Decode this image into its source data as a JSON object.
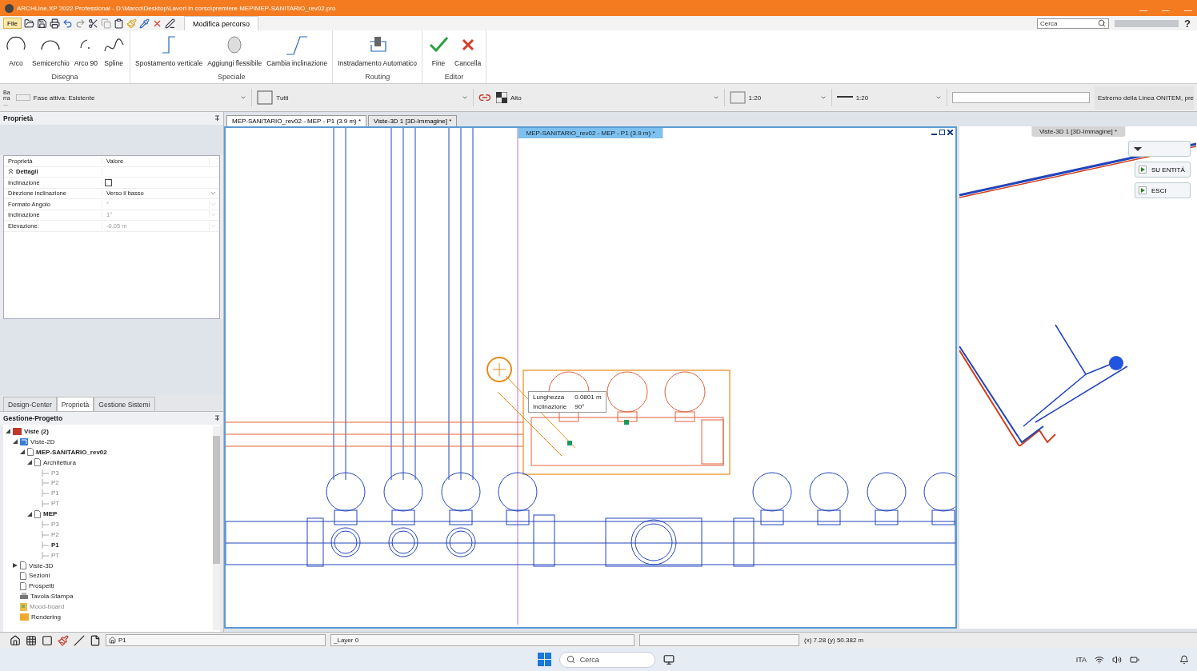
{
  "title_bar": {
    "title": "ARCHLine.XP 2022 Professional - D:\\Marco\\Desktop\\Lavori in corso\\premiere MEP\\MEP-SANITARIO_rev02.pro"
  },
  "quick_access": {
    "file_label": "File",
    "search": {
      "placeholder": "Cerca"
    },
    "help": "?"
  },
  "ribbon": {
    "tabs": [
      {
        "label": "Modifica percorso",
        "selected": true
      }
    ],
    "groups": [
      {
        "label": "Disegna",
        "tools": [
          {
            "label": "Arco",
            "kind": "arc"
          },
          {
            "label": "Semicerchio",
            "kind": "semicircle"
          },
          {
            "label": "Arco 90",
            "kind": "arc90"
          },
          {
            "label": "Spline",
            "kind": "spline"
          }
        ]
      },
      {
        "label": "Speciale",
        "tools": [
          {
            "label": "Spostamento verticale",
            "kind": "vertical"
          },
          {
            "label": "Aggiungi flessibile",
            "kind": "flex"
          },
          {
            "label": "Cambia inclinazione",
            "kind": "slope"
          }
        ]
      },
      {
        "label": "Routing",
        "tools": [
          {
            "label": "Instradamento Automatico",
            "kind": "routing"
          }
        ]
      },
      {
        "label": "Editor",
        "tools": [
          {
            "label": "Fine",
            "kind": "ok"
          },
          {
            "label": "Cancella",
            "kind": "cancel"
          }
        ]
      }
    ]
  },
  "toolbar": {
    "bar_label": "Barra ...",
    "phase": "Fase attiva: Esistente",
    "filter": "Tutti",
    "view_mode": "Alto",
    "scale_1": "1:20",
    "scale_2": "1:20",
    "hint": "Estremo della Linea ONITEM, pre"
  },
  "properties_panel": {
    "title": "Proprietà",
    "columns": [
      "Proprietà",
      "Valore"
    ],
    "section": {
      "label": "Dettagli",
      "expanded": true
    },
    "rows": [
      {
        "label": "Inclinazione",
        "kind": "checkbox",
        "checked": false,
        "disabled": false
      },
      {
        "label": "Direzione inclinazione",
        "kind": "dropdown",
        "value": "Verso il basso",
        "disabled": false
      },
      {
        "label": "Formato Angolo",
        "kind": "dropdown",
        "value": "°",
        "disabled": true
      },
      {
        "label": "Inclinazione",
        "kind": "dropdown",
        "value": "1°",
        "disabled": true
      },
      {
        "label": "Elevazione:",
        "kind": "dropdown",
        "value": "-0.05 m",
        "disabled": true
      }
    ]
  },
  "panel_tabs": [
    {
      "label": "Design-Center",
      "selected": false
    },
    {
      "label": "Proprietà",
      "selected": true
    },
    {
      "label": "Gestione Sistemi",
      "selected": false
    }
  ],
  "project_panel": {
    "title": "Gestione-Progetto",
    "tree": [
      {
        "label": "Viste (2)",
        "kind": "views",
        "active": true,
        "expanded": true,
        "children": [
          {
            "label": "Viste-2D",
            "kind": "plan",
            "active": false,
            "expanded": true,
            "children": [
              {
                "label": "MEP-SANITARIO_rev02",
                "kind": "page",
                "active": true,
                "expanded": true,
                "children": [
                  {
                    "label": "Architettura",
                    "kind": "page",
                    "active": false,
                    "expanded": true,
                    "children": [
                      {
                        "label": "P3",
                        "kind": "leaf",
                        "active": false
                      },
                      {
                        "label": "P2",
                        "kind": "leaf",
                        "active": false
                      },
                      {
                        "label": "P1",
                        "kind": "leaf",
                        "active": false
                      },
                      {
                        "label": "PT",
                        "kind": "leaf",
                        "active": false
                      }
                    ]
                  },
                  {
                    "label": "MEP",
                    "kind": "page",
                    "active": true,
                    "expanded": true,
                    "children": [
                      {
                        "label": "P3",
                        "kind": "leaf",
                        "active": false
                      },
                      {
                        "label": "P2",
                        "kind": "leaf",
                        "active": false
                      },
                      {
                        "label": "P1",
                        "kind": "leaf",
                        "active": true
                      },
                      {
                        "label": "PT",
                        "kind": "leaf",
                        "active": false
                      }
                    ]
                  }
                ]
              }
            ]
          },
          {
            "label": "Viste-3D",
            "kind": "page",
            "active": false,
            "expanded": false
          },
          {
            "label": "Sezioni",
            "kind": "page",
            "active": false
          },
          {
            "label": "Prospetti",
            "kind": "page",
            "active": false
          },
          {
            "label": "Tavola-Stampa",
            "kind": "print",
            "active": false
          },
          {
            "label": "Mood-board",
            "kind": "board",
            "active": false
          },
          {
            "label": "Rendering",
            "kind": "folder",
            "active": false
          }
        ]
      }
    ]
  },
  "document_tabs": [
    {
      "label": "MEP-SANITARIO_rev02 - MEP - P1 (3.9 m) *",
      "selected": true
    },
    {
      "label": "Viste-3D 1 [3D-Immagine] *",
      "selected": false
    }
  ],
  "viewport_2d": {
    "title": "MEP-SANITARIO_rev02 - MEP - P1 (3.9 m) *",
    "tooltip": [
      {
        "label": "Lunghezza",
        "value": "0.0801 m"
      },
      {
        "label": "Inclinazione",
        "value": "90°"
      }
    ]
  },
  "viewport_3d": {
    "title": "Viste-3D 1 [3D-Immagine] *",
    "buttons": [
      "SU ENTITÁ",
      "ESCI"
    ]
  },
  "status_bar": {
    "view": "P1",
    "layer": "_Layer 0",
    "coordinates": "(x) 7.28  (y) 50.382 m"
  },
  "taskbar": {
    "search": {
      "placeholder": "Cerca"
    },
    "language": "ITA"
  }
}
